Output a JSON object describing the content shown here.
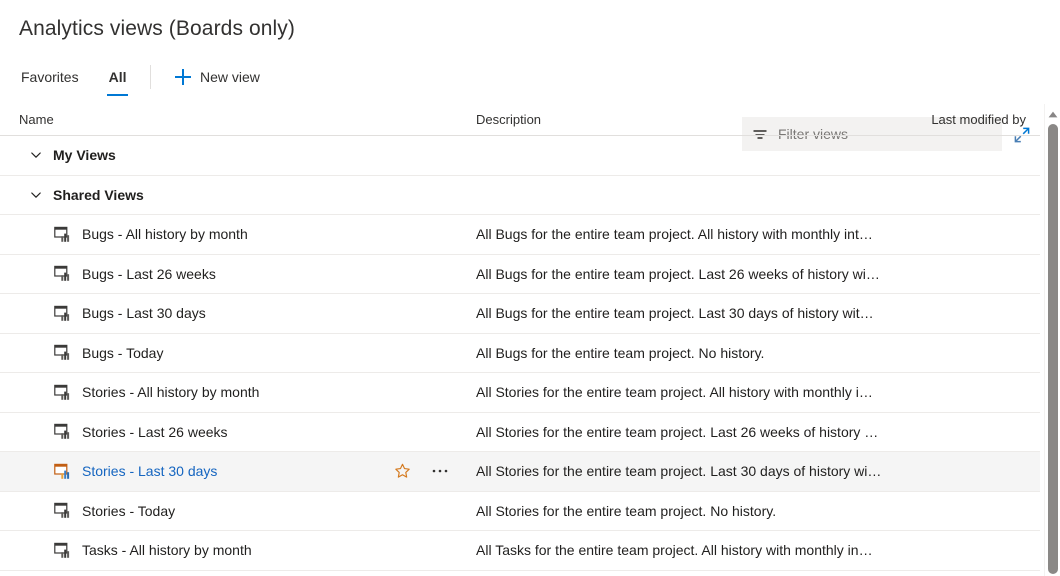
{
  "header": {
    "title": "Analytics views (Boards only)"
  },
  "command_bar": {
    "tabs": [
      {
        "label": "Favorites",
        "active": false
      },
      {
        "label": "All",
        "active": true
      }
    ],
    "new_view_label": "New view",
    "filter": {
      "placeholder": "Filter views",
      "value": ""
    },
    "expand_icon": "expand-diagonal-icon"
  },
  "colors": {
    "accent": "#0078d4",
    "link": "#1565c0",
    "star": "#d4791e",
    "row_selected_bg": "#f5f5f5",
    "row_border": "#edebe9",
    "filter_bg": "#f3f2f1",
    "scrollbar_thumb": "#8a8886"
  },
  "list": {
    "columns": {
      "name": "Name",
      "description": "Description",
      "last_modified_by": "Last modified by"
    },
    "rows": [
      {
        "kind": "group",
        "label": "My Views",
        "chevron": "chevron-down-icon"
      },
      {
        "kind": "group",
        "label": "Shared Views",
        "chevron": "chevron-down-icon"
      },
      {
        "kind": "view",
        "name": "Bugs - All history by month",
        "description": "All Bugs for the entire team project. All history with monthly int…",
        "selected": false
      },
      {
        "kind": "view",
        "name": "Bugs - Last 26 weeks",
        "description": "All Bugs for the entire team project. Last 26 weeks of history wi…",
        "selected": false
      },
      {
        "kind": "view",
        "name": "Bugs - Last 30 days",
        "description": "All Bugs for the entire team project. Last 30 days of history wit…",
        "selected": false
      },
      {
        "kind": "view",
        "name": "Bugs - Today",
        "description": "All Bugs for the entire team project. No history.",
        "selected": false
      },
      {
        "kind": "view",
        "name": "Stories - All history by month",
        "description": "All Stories for the entire team project. All history with monthly i…",
        "selected": false
      },
      {
        "kind": "view",
        "name": "Stories - Last 26 weeks",
        "description": "All Stories for the entire team project. Last 26 weeks of history …",
        "selected": false
      },
      {
        "kind": "view",
        "name": "Stories - Last 30 days",
        "description": "All Stories for the entire team project. Last 30 days of history wi…",
        "selected": true,
        "actions": {
          "favorite": "star-icon",
          "more": "···"
        }
      },
      {
        "kind": "view",
        "name": "Stories - Today",
        "description": "All Stories for the entire team project. No history.",
        "selected": false
      },
      {
        "kind": "view",
        "name": "Tasks - All history by month",
        "description": "All Tasks for the entire team project. All history with monthly in…",
        "selected": false
      }
    ]
  },
  "scrollbar": {
    "up_arrow": "caret-up-icon"
  }
}
